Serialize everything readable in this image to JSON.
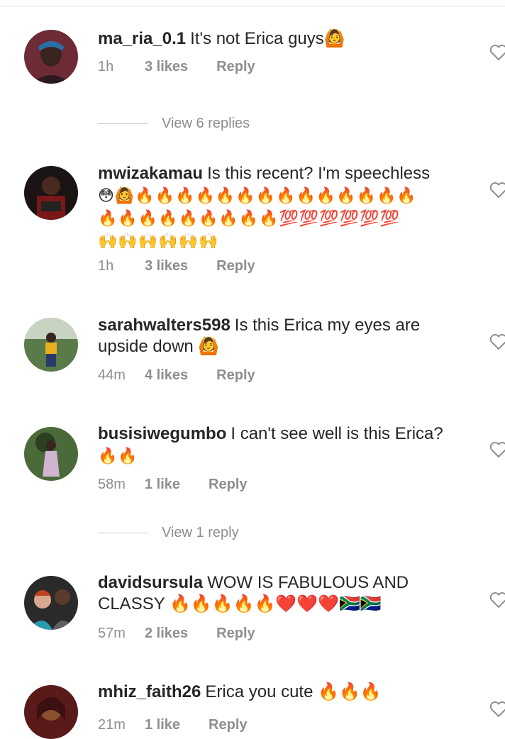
{
  "comments": [
    {
      "username": "ma_ria_0.1",
      "text": "It's not Erica guys🙆",
      "time": "1h",
      "likes": "3 likes",
      "reply": "Reply",
      "view_replies": "View 6 replies"
    },
    {
      "username": "mwizakamau",
      "text": "Is this recent? I'm speechless",
      "emoji_line1": "😳🙆🔥🔥🔥🔥🔥🔥🔥🔥🔥🔥🔥🔥🔥🔥",
      "emoji_line2": "🔥🔥🔥🔥🔥🔥🔥🔥🔥💯💯💯💯💯💯",
      "emoji_line3": "🙌🙌🙌🙌🙌🙌",
      "time": "1h",
      "likes": "3 likes",
      "reply": "Reply"
    },
    {
      "username": "sarahwalters598",
      "text": "Is this  Erica my eyes are upside down 🙆",
      "time": "44m",
      "likes": "4 likes",
      "reply": "Reply"
    },
    {
      "username": "busisiwegumbo",
      "text": "I can't see well is this Erica?",
      "emoji_line1": "🔥🔥",
      "time": "58m",
      "likes": "1 like",
      "reply": "Reply",
      "view_replies": "View 1 reply"
    },
    {
      "username": "davidsursula",
      "text": "WOW  IS FABULOUS AND CLASSY 🔥🔥🔥🔥🔥❤️❤️❤️🇿🇦🇿🇦",
      "time": "57m",
      "likes": "2 likes",
      "reply": "Reply"
    },
    {
      "username": "mhiz_faith26",
      "text": "Erica you cute 🔥🔥🔥",
      "time": "21m",
      "likes": "1 like",
      "reply": "Reply"
    }
  ],
  "colors": {
    "text": "#262626",
    "meta": "#8e8e8e",
    "divider": "#c7c7c7"
  },
  "icons": [
    "heart-icon",
    "avatar"
  ]
}
